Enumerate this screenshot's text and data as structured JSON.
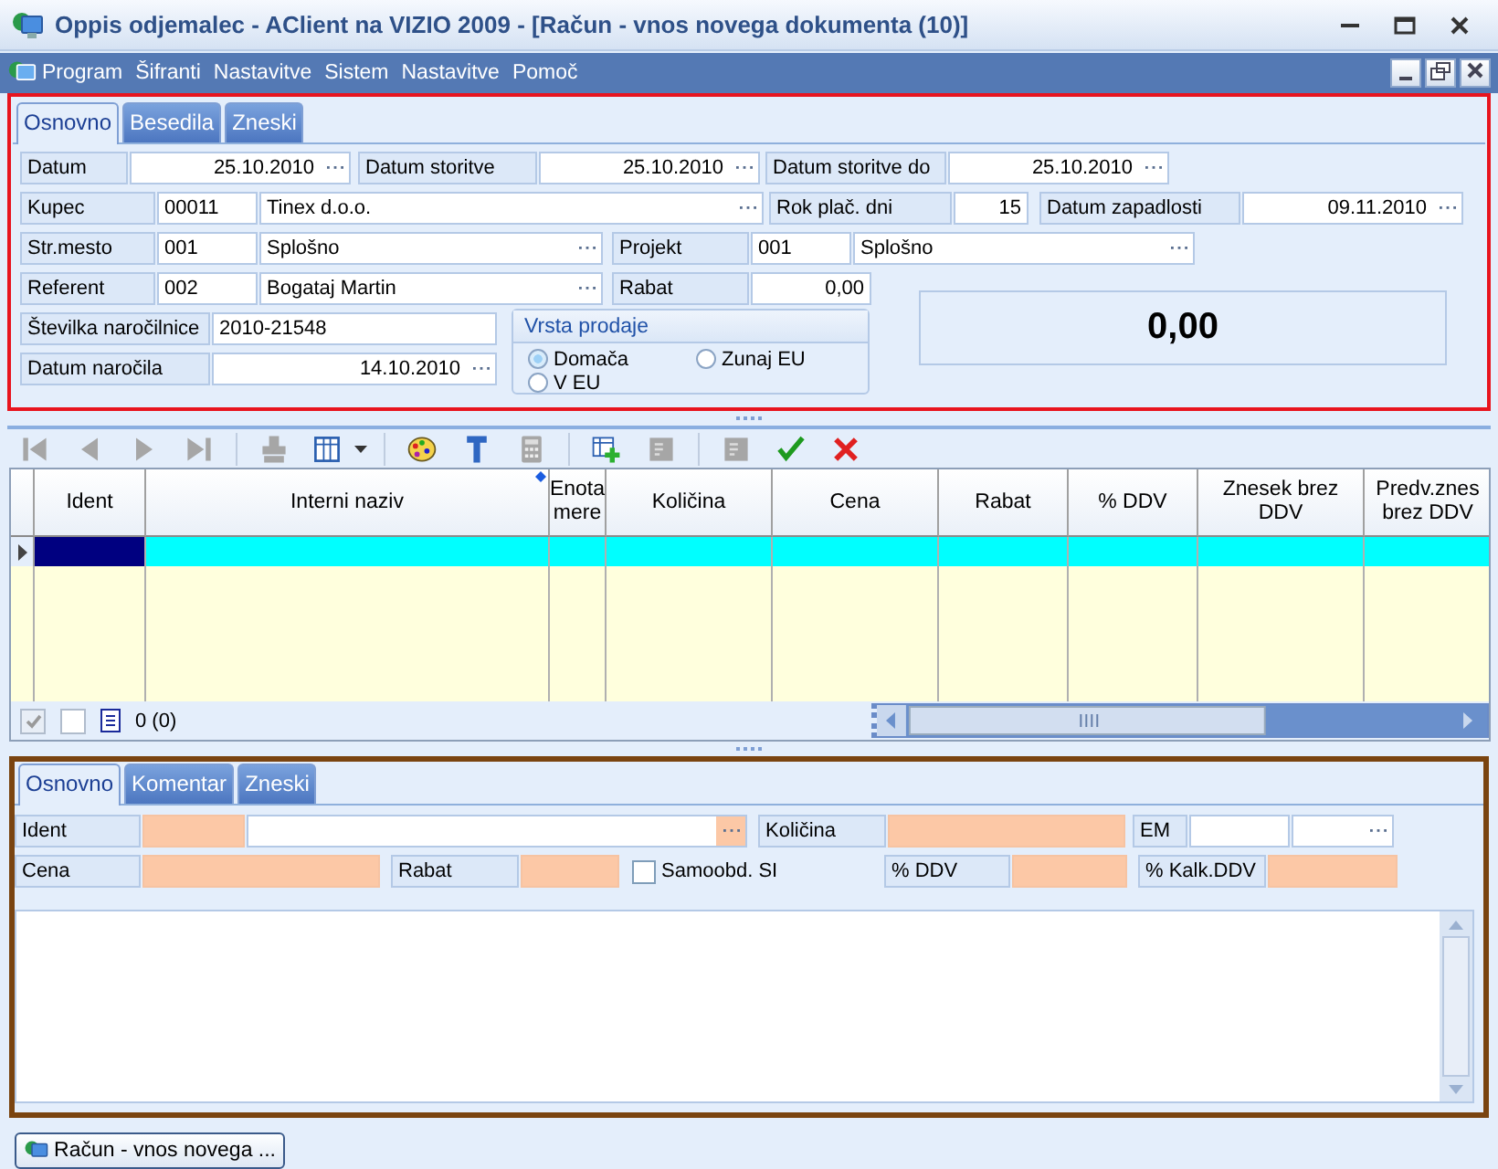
{
  "window": {
    "title": "Oppis odjemalec - AClient na VIZIO 2009 - [Račun - vnos novega dokumenta (10)]"
  },
  "menu": [
    "Program",
    "Šifranti",
    "Nastavitve",
    "Sistem",
    "Nastavitve",
    "Pomoč"
  ],
  "header": {
    "tabs": [
      {
        "label": "Osnovno",
        "selected": true
      },
      {
        "label": "Besedila",
        "selected": false
      },
      {
        "label": "Zneski",
        "selected": false
      }
    ],
    "rows": [
      [
        {
          "kind": "field",
          "label": "Datum",
          "inputs": [
            {
              "value": "25.10.2010",
              "right_aligned": true,
              "picker": true,
              "required": false
            }
          ]
        },
        {
          "kind": "field",
          "label": "Datum storitve",
          "inputs": [
            {
              "value": "25.10.2010",
              "right_aligned": true,
              "picker": true,
              "required": false
            }
          ]
        },
        {
          "kind": "field",
          "label": "Datum storitve do",
          "inputs": [
            {
              "value": "25.10.2010",
              "right_aligned": true,
              "picker": true,
              "required": false
            }
          ]
        }
      ],
      [
        {
          "kind": "field",
          "label": "Kupec",
          "inputs": [
            {
              "value": "00011",
              "required": false
            },
            {
              "value": "Tinex d.o.o.",
              "picker": true,
              "required": false
            }
          ]
        },
        {
          "kind": "field",
          "label": "Rok plač. dni",
          "inputs": [
            {
              "value": "15",
              "right_aligned": true,
              "required": false
            }
          ]
        },
        {
          "kind": "field",
          "label": "Datum zapadlosti",
          "inputs": [
            {
              "value": "09.11.2010",
              "right_aligned": true,
              "picker": true,
              "required": false
            }
          ]
        }
      ],
      [
        {
          "kind": "field",
          "label": "Str.mesto",
          "inputs": [
            {
              "value": "001",
              "required": false
            },
            {
              "value": "Splošno",
              "picker": true,
              "required": false
            }
          ]
        },
        {
          "kind": "field",
          "label": "Projekt",
          "inputs": [
            {
              "value": "001",
              "required": false
            },
            {
              "value": "Splošno",
              "picker": true,
              "required": false
            }
          ]
        }
      ],
      [
        {
          "kind": "field",
          "label": "Referent",
          "inputs": [
            {
              "value": "002",
              "required": false
            },
            {
              "value": "Bogataj Martin",
              "picker": true,
              "required": false
            }
          ]
        },
        {
          "kind": "field",
          "label": "Rabat",
          "inputs": [
            {
              "value": "0,00",
              "right_aligned": true,
              "required": false
            }
          ]
        }
      ],
      [
        {
          "kind": "field",
          "label": "Številka naročilnice",
          "inputs": [
            {
              "value": "2010-21548",
              "required": false
            }
          ]
        }
      ],
      [
        {
          "kind": "field",
          "label": "Datum naročila",
          "inputs": [
            {
              "value": "14.10.2010",
              "right_aligned": true,
              "picker": true,
              "required": false
            }
          ]
        }
      ]
    ],
    "sale_type": {
      "title": "Vrsta prodaje",
      "options": [
        {
          "label": "Domača",
          "selected": true
        },
        {
          "label": "Zunaj EU",
          "selected": false
        },
        {
          "label": "V EU",
          "selected": false
        }
      ]
    },
    "total": "0,00"
  },
  "toolbar": [
    {
      "kind": "first",
      "disabled": true
    },
    {
      "kind": "previous",
      "disabled": true
    },
    {
      "kind": "next",
      "disabled": true
    },
    {
      "kind": "last",
      "disabled": true
    },
    {
      "kind": "separator"
    },
    {
      "kind": "stamp",
      "disabled": true
    },
    {
      "kind": "columns",
      "disabled": false
    },
    {
      "kind": "separator"
    },
    {
      "kind": "palette",
      "disabled": false
    },
    {
      "kind": "tool",
      "disabled": false
    },
    {
      "kind": "calculator",
      "disabled": true
    },
    {
      "kind": "separator"
    },
    {
      "kind": "add_row",
      "disabled": false
    },
    {
      "kind": "note",
      "disabled": true
    },
    {
      "kind": "separator"
    },
    {
      "kind": "note",
      "disabled": true
    },
    {
      "kind": "confirm",
      "disabled": false
    },
    {
      "kind": "cancel",
      "disabled": false
    }
  ],
  "grid": {
    "columns": [
      {
        "label": "Ident"
      },
      {
        "label": "Interni naziv",
        "marker": true
      },
      {
        "label": "Enota mere"
      },
      {
        "label": "Količina"
      },
      {
        "label": "Cena"
      },
      {
        "label": "Rabat"
      },
      {
        "label": "% DDV"
      },
      {
        "label": "Znesek brez DDV"
      },
      {
        "label": "Predv.znes brez DDV"
      }
    ],
    "rows": [
      {
        "selected": true
      }
    ],
    "footer": {
      "checks": [
        {
          "checked": true,
          "disabled": true
        },
        {
          "checked": false,
          "disabled": false
        }
      ],
      "count": "0 (0)"
    }
  },
  "detail": {
    "tabs": [
      {
        "label": "Osnovno",
        "selected": true
      },
      {
        "label": "Komentar",
        "selected": false
      },
      {
        "label": "Zneski",
        "selected": false
      }
    ],
    "fields": [
      {
        "kind": "field",
        "label": "Ident",
        "inputs": [
          {
            "required": true
          },
          {
            "required": false,
            "picker": true,
            "picker_required": true
          }
        ]
      },
      {
        "kind": "field",
        "label": "Količina",
        "inputs": [
          {
            "required": true
          }
        ]
      },
      {
        "kind": "field",
        "label": "EM",
        "inputs": [
          {
            "required": false
          },
          {
            "required": false,
            "picker": true
          }
        ]
      },
      {
        "kind": "field",
        "label": "Cena",
        "inputs": [
          {
            "required": true
          }
        ]
      },
      {
        "kind": "field",
        "label": "Rabat",
        "inputs": [
          {
            "required": true
          }
        ]
      },
      {
        "kind": "check",
        "text": "Samoobd. SI",
        "checked": false
      },
      {
        "kind": "field",
        "label": "% DDV",
        "inputs": [
          {
            "required": true
          }
        ]
      },
      {
        "kind": "field",
        "label": "% Kalk.DDV",
        "inputs": [
          {
            "required": true
          }
        ]
      }
    ]
  },
  "taskbar": [
    {
      "label": "Račun - vnos novega ..."
    }
  ]
}
